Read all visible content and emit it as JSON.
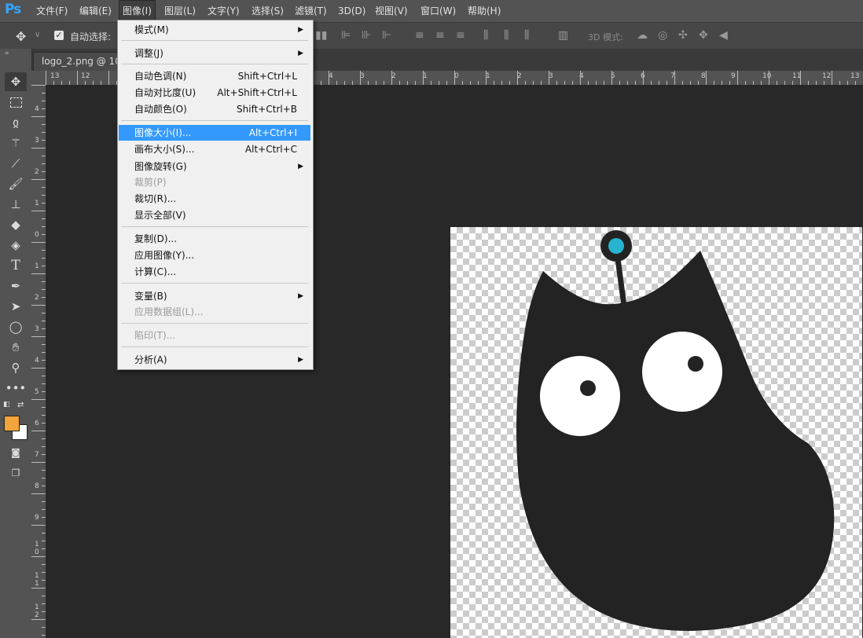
{
  "app": {
    "logo": "Ps"
  },
  "menubar": {
    "items": [
      "文件(F)",
      "编辑(E)",
      "图像(I)",
      "图层(L)",
      "文字(Y)",
      "选择(S)",
      "滤镜(T)",
      "3D(D)",
      "视图(V)",
      "窗口(W)",
      "帮助(H)"
    ]
  },
  "options": {
    "auto_select_label": "自动选择:",
    "mode_3d_label": "3D 模式:"
  },
  "document": {
    "tab_title": "logo_2.png @ 104"
  },
  "image_menu": {
    "items": [
      {
        "label": "模式(M)",
        "shortcut": "",
        "submenu": true,
        "disabled": false
      },
      {
        "label": "调整(J)",
        "shortcut": "",
        "submenu": true,
        "disabled": false
      },
      {
        "label": "自动色调(N)",
        "shortcut": "Shift+Ctrl+L",
        "submenu": false,
        "disabled": false
      },
      {
        "label": "自动对比度(U)",
        "shortcut": "Alt+Shift+Ctrl+L",
        "submenu": false,
        "disabled": false
      },
      {
        "label": "自动颜色(O)",
        "shortcut": "Shift+Ctrl+B",
        "submenu": false,
        "disabled": false
      },
      {
        "label": "图像大小(I)...",
        "shortcut": "Alt+Ctrl+I",
        "submenu": false,
        "disabled": false,
        "highlighted": true
      },
      {
        "label": "画布大小(S)...",
        "shortcut": "Alt+Ctrl+C",
        "submenu": false,
        "disabled": false
      },
      {
        "label": "图像旋转(G)",
        "shortcut": "",
        "submenu": true,
        "disabled": false
      },
      {
        "label": "裁剪(P)",
        "shortcut": "",
        "submenu": false,
        "disabled": true
      },
      {
        "label": "裁切(R)...",
        "shortcut": "",
        "submenu": false,
        "disabled": false
      },
      {
        "label": "显示全部(V)",
        "shortcut": "",
        "submenu": false,
        "disabled": false
      },
      {
        "label": "复制(D)...",
        "shortcut": "",
        "submenu": false,
        "disabled": false
      },
      {
        "label": "应用图像(Y)...",
        "shortcut": "",
        "submenu": false,
        "disabled": false
      },
      {
        "label": "计算(C)...",
        "shortcut": "",
        "submenu": false,
        "disabled": false
      },
      {
        "label": "变量(B)",
        "shortcut": "",
        "submenu": true,
        "disabled": false
      },
      {
        "label": "应用数据组(L)...",
        "shortcut": "",
        "submenu": false,
        "disabled": true
      },
      {
        "label": "陷印(T)...",
        "shortcut": "",
        "submenu": false,
        "disabled": true
      },
      {
        "label": "分析(A)",
        "shortcut": "",
        "submenu": true,
        "disabled": false
      }
    ]
  },
  "rulers": {
    "top_labels": [
      "13",
      "12",
      "4",
      "3",
      "2",
      "1",
      "0",
      "1",
      "2",
      "3",
      "4",
      "5",
      "6",
      "7",
      "8",
      "9",
      "10",
      "11",
      "12",
      "13"
    ],
    "left_labels": [
      "4",
      "3",
      "2",
      "1",
      "0",
      "1",
      "2",
      "3",
      "4",
      "5",
      "6",
      "7",
      "8",
      "9",
      "1 0",
      "1 1",
      "1 2"
    ]
  },
  "colors": {
    "foreground": "#f2a53a",
    "background": "#ffffff",
    "highlight": "#3399ff",
    "antenna_tip": "#27b4cf",
    "creature": "#232323"
  },
  "tools": [
    "move-icon",
    "marquee-icon",
    "lasso-icon",
    "magic-wand-icon",
    "eyedropper-icon",
    "brush-icon",
    "stamp-icon",
    "eraser-icon",
    "paint-bucket-icon",
    "type-icon",
    "pen-icon",
    "path-select-icon",
    "ellipse-icon",
    "hand-icon",
    "zoom-icon",
    "more-icon"
  ]
}
